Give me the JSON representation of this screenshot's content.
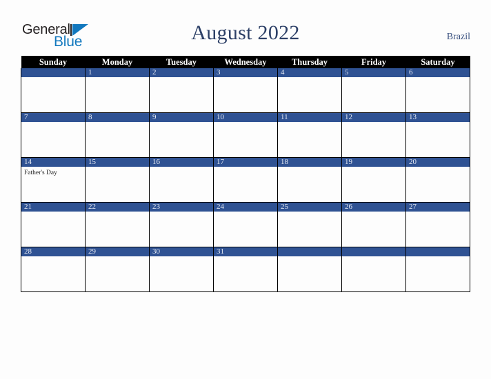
{
  "brand": {
    "name_part1": "General",
    "name_part2": "Blue",
    "mark": "triangle-logo-icon",
    "color_dark": "#231f20",
    "color_blue": "#1278be"
  },
  "header": {
    "title": "August 2022",
    "region": "Brazil",
    "title_color": "#2c3f66"
  },
  "calendar": {
    "accent_color": "#2f5293",
    "header_bg": "#000000",
    "weekday_headers": [
      "Sunday",
      "Monday",
      "Tuesday",
      "Wednesday",
      "Thursday",
      "Friday",
      "Saturday"
    ],
    "weeks": [
      [
        {
          "day": "",
          "events": []
        },
        {
          "day": "1",
          "events": []
        },
        {
          "day": "2",
          "events": []
        },
        {
          "day": "3",
          "events": []
        },
        {
          "day": "4",
          "events": []
        },
        {
          "day": "5",
          "events": []
        },
        {
          "day": "6",
          "events": []
        }
      ],
      [
        {
          "day": "7",
          "events": []
        },
        {
          "day": "8",
          "events": []
        },
        {
          "day": "9",
          "events": []
        },
        {
          "day": "10",
          "events": []
        },
        {
          "day": "11",
          "events": []
        },
        {
          "day": "12",
          "events": []
        },
        {
          "day": "13",
          "events": []
        }
      ],
      [
        {
          "day": "14",
          "events": [
            "Father's Day"
          ]
        },
        {
          "day": "15",
          "events": []
        },
        {
          "day": "16",
          "events": []
        },
        {
          "day": "17",
          "events": []
        },
        {
          "day": "18",
          "events": []
        },
        {
          "day": "19",
          "events": []
        },
        {
          "day": "20",
          "events": []
        }
      ],
      [
        {
          "day": "21",
          "events": []
        },
        {
          "day": "22",
          "events": []
        },
        {
          "day": "23",
          "events": []
        },
        {
          "day": "24",
          "events": []
        },
        {
          "day": "25",
          "events": []
        },
        {
          "day": "26",
          "events": []
        },
        {
          "day": "27",
          "events": []
        }
      ],
      [
        {
          "day": "28",
          "events": []
        },
        {
          "day": "29",
          "events": []
        },
        {
          "day": "30",
          "events": []
        },
        {
          "day": "31",
          "events": []
        },
        {
          "day": "",
          "events": []
        },
        {
          "day": "",
          "events": []
        },
        {
          "day": "",
          "events": []
        }
      ]
    ]
  }
}
